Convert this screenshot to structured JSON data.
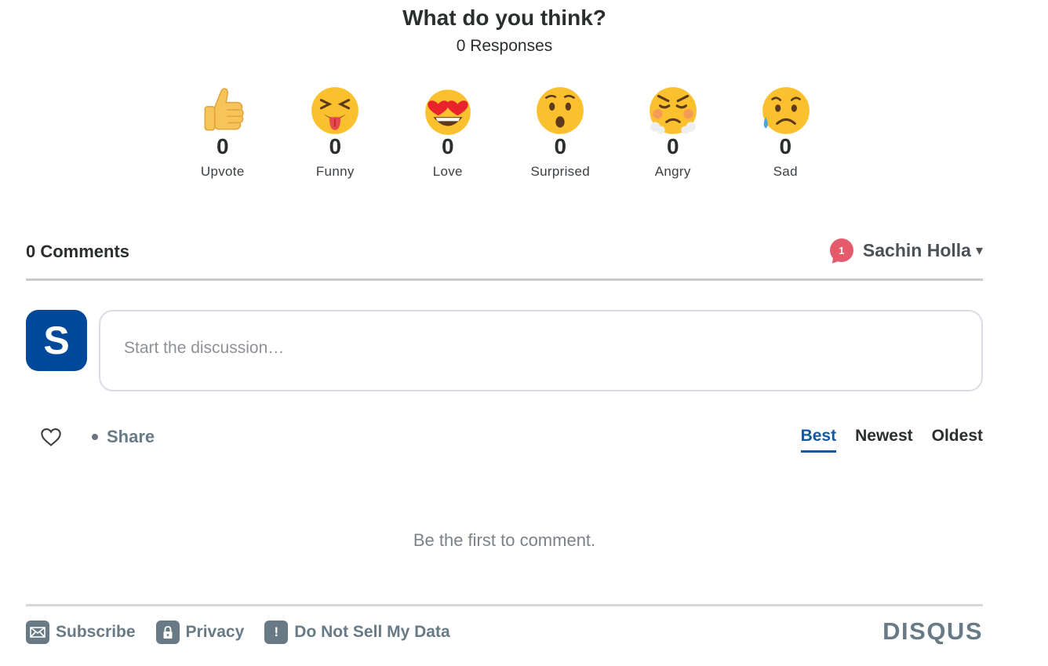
{
  "reactions": {
    "title": "What do you think?",
    "responses": "0 Responses",
    "items": [
      {
        "label": "Upvote",
        "count": "0",
        "icon": "thumbs-up-icon"
      },
      {
        "label": "Funny",
        "count": "0",
        "icon": "squinting-tongue-face-icon"
      },
      {
        "label": "Love",
        "count": "0",
        "icon": "heart-eyes-face-icon"
      },
      {
        "label": "Surprised",
        "count": "0",
        "icon": "hushed-face-icon"
      },
      {
        "label": "Angry",
        "count": "0",
        "icon": "steam-nose-face-icon"
      },
      {
        "label": "Sad",
        "count": "0",
        "icon": "sad-sweat-face-icon"
      }
    ]
  },
  "comments": {
    "count_label": "0 Comments",
    "notification_count": "1",
    "user_name": "Sachin Holla",
    "caret": "▾",
    "avatar_letter": "S",
    "composer_placeholder": "Start the discussion…",
    "share_label": "Share",
    "sort_tabs": [
      {
        "label": "Best",
        "active": true
      },
      {
        "label": "Newest",
        "active": false
      },
      {
        "label": "Oldest",
        "active": false
      }
    ],
    "empty_message": "Be the first to comment."
  },
  "footer": {
    "links": [
      {
        "label": "Subscribe",
        "icon": "envelope-icon"
      },
      {
        "label": "Privacy",
        "icon": "lock-icon"
      },
      {
        "label": "Do Not Sell My Data",
        "icon": "exclamation-icon"
      }
    ],
    "brand": "DISQUS"
  },
  "colors": {
    "avatar_bg": "#00489a",
    "accent": "#1459a4",
    "badge": "#e55b6c",
    "muted": "#687a86"
  }
}
